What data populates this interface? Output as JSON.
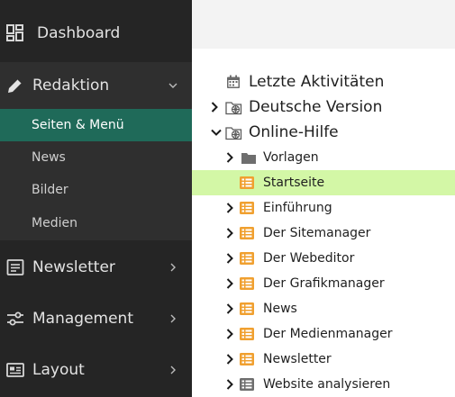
{
  "sidebar": {
    "dashboard": "Dashboard",
    "redaktion": "Redaktion",
    "sub": [
      "Seiten & Menü",
      "News",
      "Bilder",
      "Medien"
    ],
    "newsletter": "Newsletter",
    "management": "Management",
    "layout": "Layout"
  },
  "tree": {
    "root": [
      {
        "label": "Letzte Aktivitäten",
        "icon": "calendar-icon"
      },
      {
        "label": "Deutsche Version",
        "icon": "globe-folder-icon"
      },
      {
        "label": "Online-Hilfe",
        "icon": "globe-folder-icon"
      }
    ],
    "children": [
      {
        "label": "Vorlagen",
        "icon": "folder-icon"
      },
      {
        "label": "Startseite",
        "icon": "page-list-icon"
      },
      {
        "label": "Einführung",
        "icon": "page-list-icon"
      },
      {
        "label": "Der Sitemanager",
        "icon": "page-list-icon"
      },
      {
        "label": "Der Webeditor",
        "icon": "page-list-icon"
      },
      {
        "label": "Der Grafikmanager",
        "icon": "page-list-icon"
      },
      {
        "label": "News",
        "icon": "page-list-icon"
      },
      {
        "label": "Der Medienmanager",
        "icon": "page-list-icon"
      },
      {
        "label": "Newsletter",
        "icon": "page-list-icon"
      },
      {
        "label": "Website analysieren",
        "icon": "page-list-gray-icon"
      }
    ]
  },
  "colors": {
    "sidebar_bg": "#252525",
    "submenu_bg": "#2f2f2f",
    "active_item": "#1f6a59",
    "selected_row": "#d3f7a6",
    "page_icon": "#f0a030"
  }
}
